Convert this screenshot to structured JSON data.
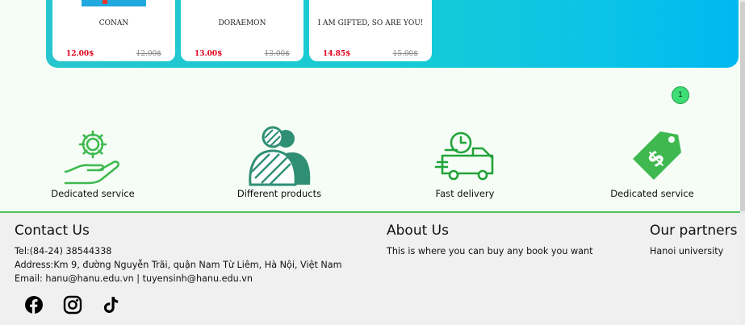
{
  "books": [
    {
      "title": "CONAN",
      "price": "12.00$",
      "old_price": "12.00$"
    },
    {
      "title": "DORAEMON",
      "price": "13.00$",
      "old_price": "13.00$"
    },
    {
      "title": "I AM GIFTED, SO ARE YOU!",
      "price": "14.85$",
      "old_price": "15.00$"
    }
  ],
  "pagination": {
    "current": "1"
  },
  "services": [
    {
      "label": "Dedicated service",
      "icon": "gear-hand-icon"
    },
    {
      "label": "Different products",
      "icon": "people-icon"
    },
    {
      "label": "Fast delivery",
      "icon": "delivery-truck-icon"
    },
    {
      "label": "Dedicated service",
      "icon": "price-tag-icon"
    }
  ],
  "footer": {
    "contact": {
      "title": "Contact Us",
      "tel": "Tel:(84-24) 38544338",
      "address": "Address:Km 9, đường Nguyễn Trãi, quận Nam Từ Liêm, Hà Nội, Việt Nam",
      "email": "Email: hanu@hanu.edu.vn | tuyensinh@hanu.edu.vn"
    },
    "about": {
      "title": "About Us",
      "text": "This is where you can buy any book you want"
    },
    "partners": {
      "title": "Our partners",
      "text": "Hanoi university"
    },
    "social": [
      "facebook-icon",
      "instagram-icon",
      "tiktok-icon"
    ]
  },
  "colors": {
    "accent_green": "#52c25c",
    "price_red": "#e0001b",
    "panel_cyan": "#17cbd4",
    "service_green": "#3fb94f",
    "service_teal": "#2f8f74"
  }
}
